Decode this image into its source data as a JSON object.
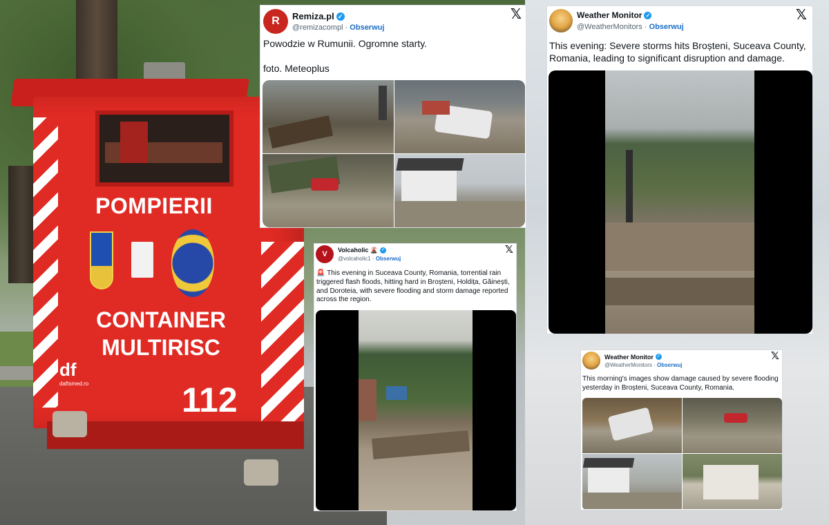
{
  "container": {
    "title": "POMPIERII",
    "label_line1": "CONTAINER",
    "label_line2": "MULTIRISC",
    "number": "112",
    "logo_text": "df",
    "logo_sub": "daftsmed.ro"
  },
  "tweets": [
    {
      "id": "t1",
      "name": "Remiza.pl",
      "handle": "@remizacompl",
      "follow": "Obserwuj",
      "avatar_text": "R",
      "text_line1": "Powodzie w Rumunii. Ogromne starty.",
      "text_line2": "foto. Meteoplus",
      "media": [
        "debris-street-photo",
        "wrecked-car-photo",
        "red-car-in-mud-photo",
        "flooded-house-photo"
      ]
    },
    {
      "id": "t2",
      "name": "Weather Monitor",
      "handle": "@WeatherMonitors",
      "follow": "Obserwuj",
      "text": "This evening: Severe storms hits Broșteni, Suceava County, Romania, leading to significant disruption and damage.",
      "media": [
        "flood-river-video"
      ]
    },
    {
      "id": "t3",
      "name": "Volcaholic 🌋",
      "handle": "@volcaholic1",
      "follow": "Obserwuj",
      "avatar_text": "V",
      "text": "This evening in Suceava County, Romania, torrential rain triggered flash floods, hitting hard in Broșteni, Holdița, Găinești, and Doroteia, with severe flooding and storm damage reported across the region.",
      "siren": "🚨",
      "media": [
        "flash-flood-street-video"
      ]
    },
    {
      "id": "t4",
      "name": "Weather Monitor",
      "handle": "@WeatherMonitors",
      "follow": "Obserwuj",
      "text": "This morning's images show damage caused by severe flooding yesterday in Broșteni, Suceava County, Romania.",
      "media": [
        "car-in-debris-photo",
        "red-car-photo",
        "flooded-house-photo",
        "damaged-wall-photo"
      ]
    }
  ],
  "colors": {
    "x_blue": "#1d9bf0",
    "follow_blue": "#1d6fc6",
    "fire_red": "#e02a24"
  },
  "icons": {
    "close": "x-logo-icon",
    "verified": "verified-badge-icon"
  }
}
